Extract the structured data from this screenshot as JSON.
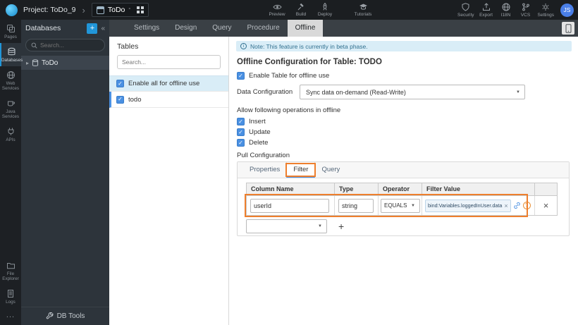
{
  "topbar": {
    "project_label": "Project: ToDo_9",
    "app_name": "ToDo",
    "nav": {
      "preview": "Preview",
      "build": "Build",
      "deploy": "Deploy",
      "tutorials": "Tutorials"
    },
    "right": {
      "security": "Security",
      "export": "Export",
      "i18n": "I18N",
      "vcs": "VCS",
      "settings": "Settings"
    },
    "avatar_initials": "JS"
  },
  "tabbar": {
    "tabs": [
      "Settings",
      "Design",
      "Query",
      "Procedure",
      "Offline"
    ],
    "active_tab": "Offline"
  },
  "left_rail": {
    "items": [
      "Pages",
      "Databases",
      "Web Services",
      "Java Services",
      "APIs"
    ],
    "bottom_items": [
      "File Explorer",
      "Logs"
    ],
    "overflow_label": "..."
  },
  "db_panel": {
    "title": "Databases",
    "add_label": "+",
    "collapse_label": "«",
    "search_placeholder": "Search...",
    "tree_items": [
      "ToDo"
    ],
    "footer_label": "DB Tools"
  },
  "tables_panel": {
    "title": "Tables",
    "search_placeholder": "Search...",
    "enable_all_label": "Enable all for offline use",
    "enable_all_checked": true,
    "tables": [
      "todo"
    ]
  },
  "main": {
    "beta_note": "Note: This feature is currently in beta phase.",
    "heading": "Offline Configuration for Table: TODO",
    "enable_table_label": "Enable Table for offline use",
    "data_configuration": {
      "label": "Data Configuration",
      "value": "Sync data on-demand (Read-Write)"
    },
    "operations_label": "Allow following operations in offline",
    "operations": [
      "Insert",
      "Update",
      "Delete"
    ],
    "pull_configuration_label": "Pull Configuration",
    "pull_tabs": [
      "Properties",
      "Filter",
      "Query"
    ],
    "active_pull_tab": "Filter",
    "filter_grid": {
      "headers": [
        "Column Name",
        "Type",
        "Operator",
        "Filter Value"
      ],
      "row": {
        "column_name": "userId",
        "type": "string",
        "operator": "EQUALS",
        "filter_value": "bind:Variables.loggedInUser.data"
      },
      "token_close": "×",
      "remove_label": "×",
      "add_label": "+"
    }
  },
  "annotations": {
    "color": "#ee7f2d",
    "targets": [
      "filter-pull-tab",
      "filter-row"
    ]
  }
}
